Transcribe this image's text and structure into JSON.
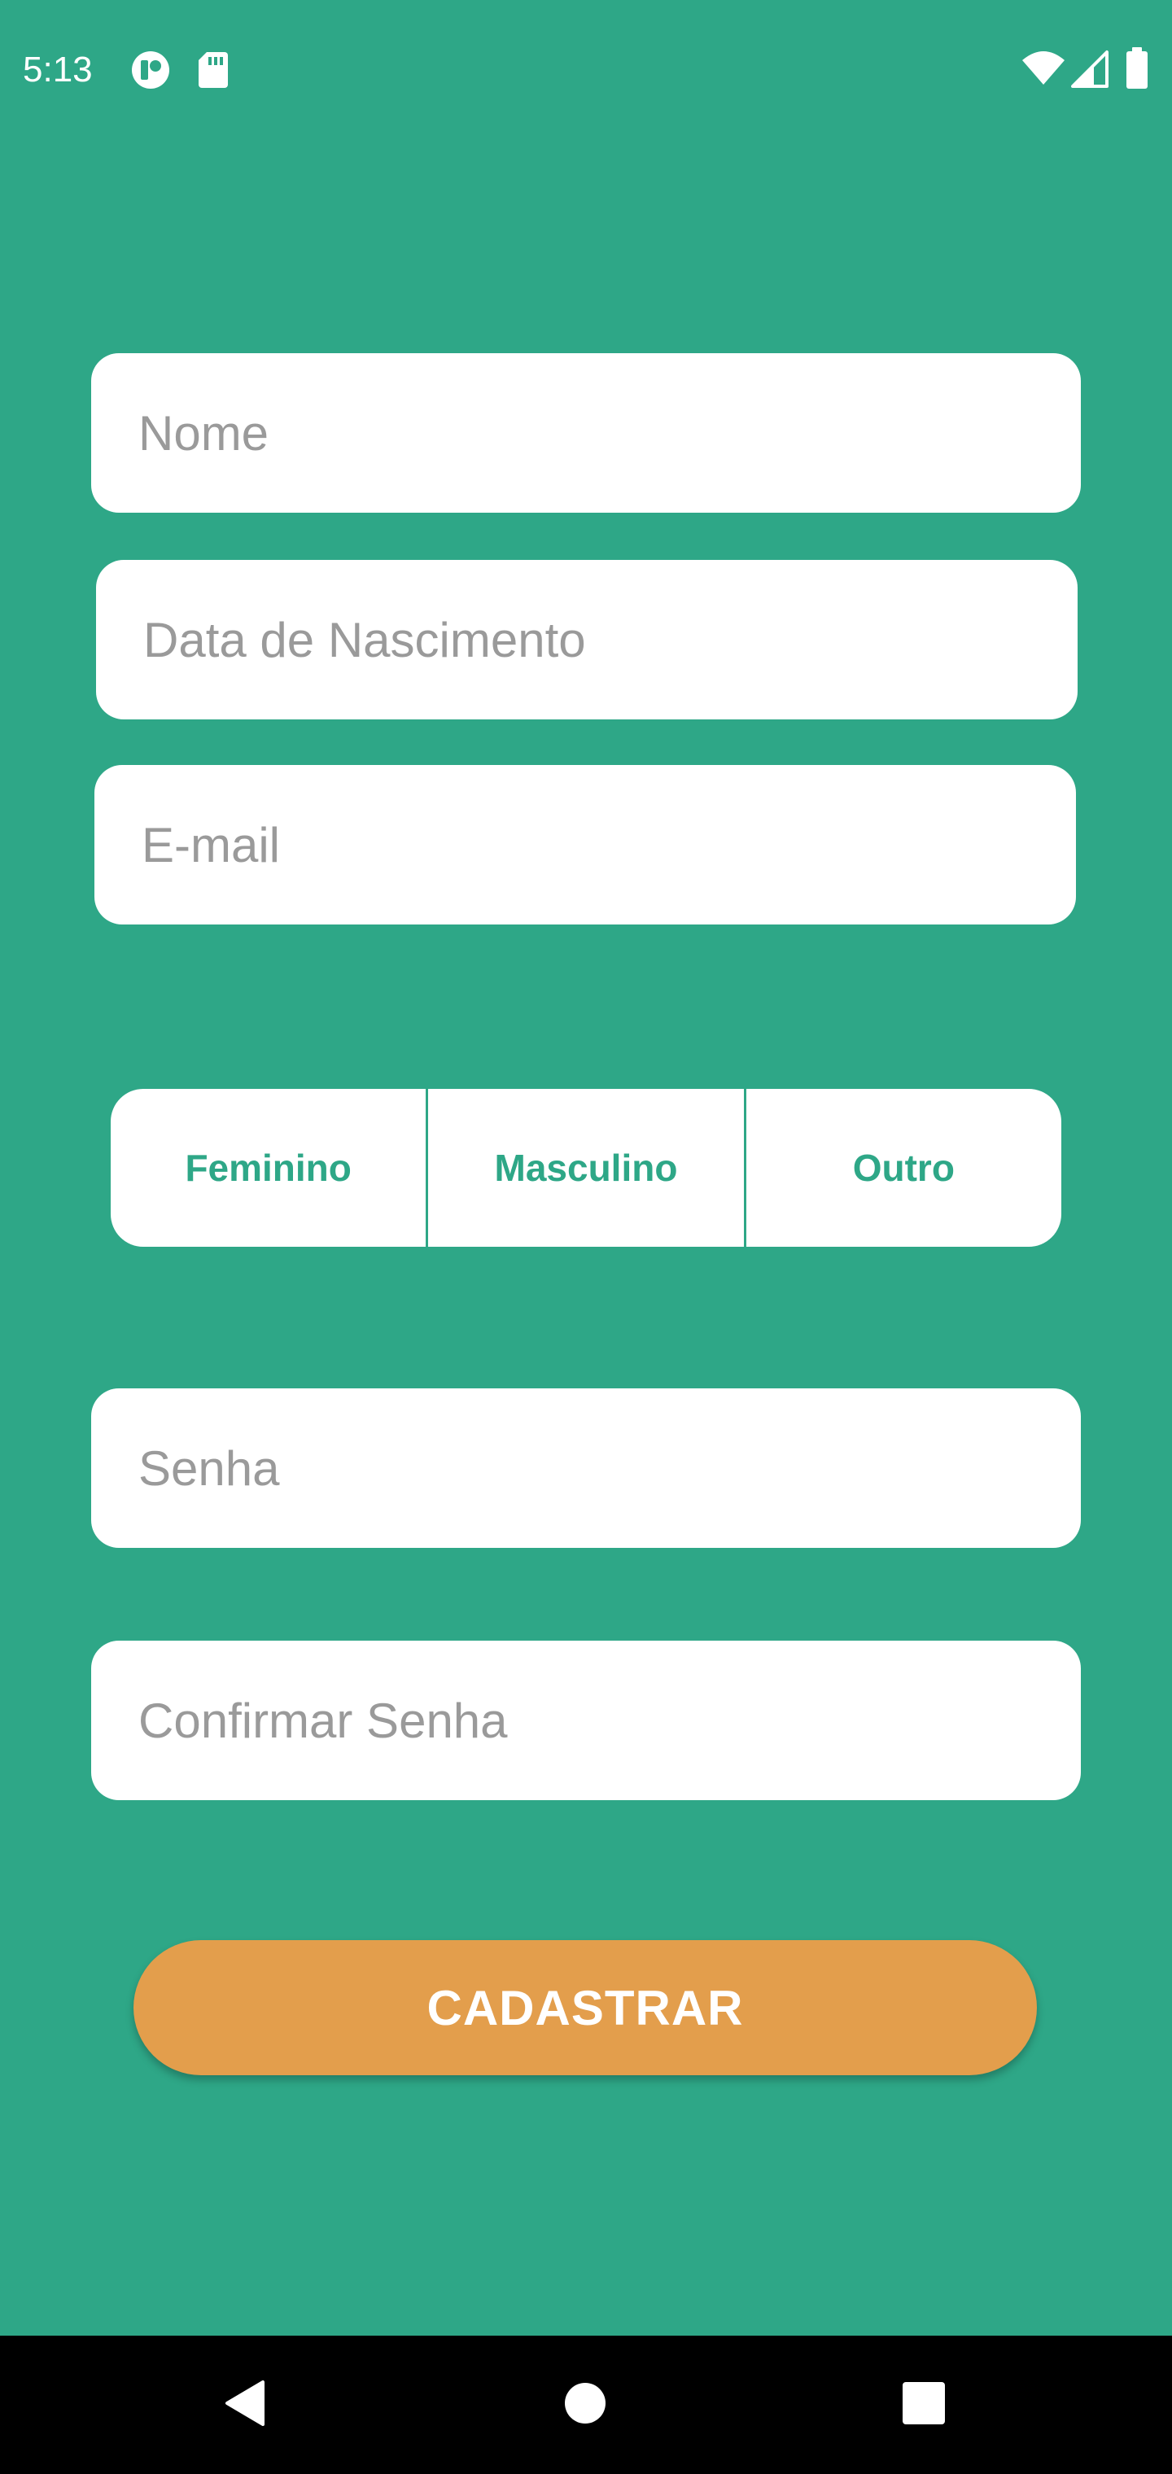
{
  "status_bar": {
    "time": "5:13",
    "left_icons": [
      "notification-app-icon",
      "sd-card-icon"
    ],
    "right_icons": [
      "wifi-icon",
      "cellular-signal-icon",
      "battery-icon"
    ]
  },
  "form": {
    "name_placeholder": "Nome",
    "birthdate_placeholder": "Data de Nascimento",
    "email_placeholder": "E-mail",
    "gender_options": [
      "Feminino",
      "Masculino",
      "Outro"
    ],
    "password_placeholder": "Senha",
    "confirm_password_placeholder": "Confirmar Senha",
    "submit_label": "CADASTRAR"
  },
  "nav_bar": {
    "buttons": [
      "back-icon",
      "home-icon",
      "recents-icon"
    ]
  },
  "colors": {
    "background": "#2ea787",
    "accent": "#2ea787",
    "button": "#e39e4c",
    "input_bg": "#ffffff",
    "placeholder": "#9a9a9a",
    "nav_bar": "#000000"
  }
}
